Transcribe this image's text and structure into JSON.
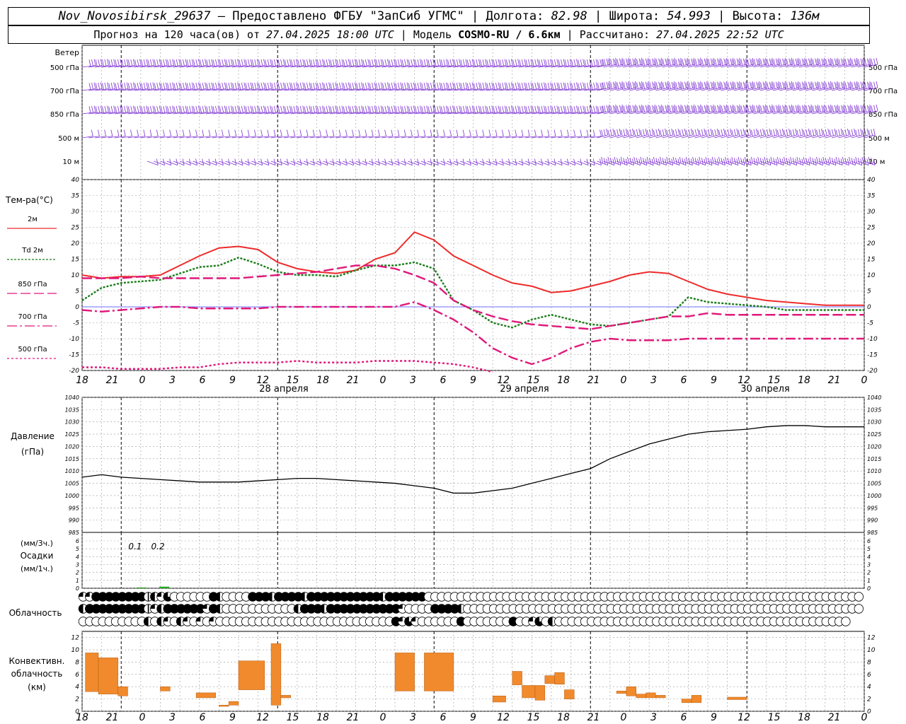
{
  "header": {
    "station": "Nov_Novosibirsk_29637",
    "provider": "— Предоставлено ФГБУ \"ЗапСиб УГМС\"",
    "lon_label": "Долгота:",
    "lon": "82.98",
    "lat_label": "Широта:",
    "lat": "54.993",
    "alt_label": "Высота:",
    "alt": "136м",
    "forecast_prefix": "Прогноз на 120 часа(ов) от",
    "forecast_start": "27.04.2025 18:00 UTC",
    "model_label": "Модель",
    "model": "COSMO-RU / 6.6км",
    "calc_label": "Рассчитано:",
    "calc_time": "27.04.2025 22:52 UTC"
  },
  "colors": {
    "wind": "#7b2fd0",
    "t2m": "#ee2b2b",
    "td2m": "#1a7d1a",
    "t850": "#e0187a",
    "t700": "#e0187a",
    "t500": "#e0187a",
    "pressure": "#000000",
    "precip": "#22aa22",
    "convective": "#f08a2c",
    "zero_line": "#4444ff",
    "grid": "#999999"
  },
  "time_axis": {
    "tick_labels": [
      "18",
      "21",
      "0",
      "3",
      "6",
      "9",
      "12",
      "15",
      "18",
      "21",
      "0",
      "3",
      "6",
      "9",
      "12",
      "15",
      "18",
      "21",
      "0",
      "3",
      "6",
      "9",
      "12",
      "15",
      "18",
      "21",
      "0"
    ],
    "day_labels": [
      {
        "index": 6,
        "text": "28 апреля"
      },
      {
        "index": 14,
        "text": "29 апреля"
      },
      {
        "index": 22,
        "text": "30 апреля"
      }
    ]
  },
  "wind_panel": {
    "title": "Ветер",
    "levels": [
      "500 гПа",
      "700 гПа",
      "850 гПа",
      "500 м",
      "10 м"
    ]
  },
  "chart_data": [
    {
      "type": "line",
      "title": "Тем-ра(°C)",
      "ylim": [
        -20,
        40
      ],
      "yticks": [
        -20,
        -15,
        -10,
        -5,
        0,
        5,
        10,
        15,
        20,
        25,
        30,
        35,
        40
      ],
      "x_hours": [
        0,
        3,
        6,
        9,
        12,
        15,
        18,
        21,
        24,
        27,
        30,
        33,
        36,
        39,
        42,
        45,
        48,
        51,
        54,
        57,
        60,
        63,
        66,
        69,
        72,
        75,
        78,
        81,
        84,
        87,
        90,
        93,
        96,
        99,
        102,
        105,
        108,
        111,
        114,
        117,
        120
      ],
      "series": [
        {
          "name": "2м",
          "key": "t2m",
          "dash": "",
          "values": [
            10,
            9,
            9.5,
            9.5,
            10,
            13,
            16,
            18.5,
            19,
            18,
            14,
            12,
            11,
            10.5,
            11.5,
            15,
            17,
            23.5,
            21,
            16,
            13,
            10,
            7.5,
            6.5,
            4.5,
            5,
            6.5,
            8,
            10,
            11,
            10.5,
            8,
            5.5,
            4,
            3,
            2,
            1.5,
            1,
            0.5,
            0.5,
            0.5
          ]
        },
        {
          "name": "Td 2м",
          "key": "td2m",
          "dash": "3,2",
          "values": [
            2,
            6,
            7.5,
            8,
            8.5,
            10.5,
            12.5,
            13,
            15.5,
            13.5,
            11,
            10,
            10,
            9.5,
            11.5,
            13,
            13,
            14,
            12,
            2,
            -1,
            -5,
            -6.5,
            -4,
            -2.5,
            -4,
            -5.5,
            -6,
            -5,
            -4,
            -3,
            3,
            1.5,
            1,
            0.5,
            0,
            -1,
            -1,
            -1,
            -1,
            -1
          ]
        },
        {
          "name": "850 гПа",
          "key": "t850",
          "dash": "14,5",
          "values": [
            9,
            9,
            9,
            9.5,
            9,
            9,
            9,
            9,
            9,
            9.5,
            10,
            10.5,
            11,
            12,
            13,
            13,
            12,
            10,
            7.5,
            2,
            -1,
            -3,
            -4.5,
            -5.5,
            -6,
            -6.5,
            -7,
            -6,
            -5,
            -4,
            -3,
            -3,
            -2,
            -2.5,
            -2.5,
            -2.5,
            -2.5,
            -2.5,
            -2.5,
            -2.5,
            -2.5
          ]
        },
        {
          "name": "700 гПа",
          "key": "t700",
          "dash": "14,4,3,4",
          "values": [
            -1,
            -1.5,
            -1,
            -0.5,
            0,
            0,
            -0.5,
            -0.5,
            -0.5,
            -0.5,
            0,
            0,
            0,
            0,
            0,
            0,
            0,
            1.5,
            -1,
            -4,
            -8,
            -13,
            -16,
            -18,
            -16,
            -13,
            -11,
            -10,
            -10.5,
            -10.5,
            -10.5,
            -10,
            -10,
            -10,
            -10,
            -10,
            -10,
            -10,
            -10,
            -10,
            -10
          ]
        },
        {
          "name": "500 гПа",
          "key": "t500",
          "dash": "3,3",
          "values": [
            -19,
            -19,
            -19.5,
            -19.5,
            -19.5,
            -19,
            -19,
            -18,
            -17.5,
            -17.5,
            -17.5,
            -17,
            -17.5,
            -17.5,
            -17.5,
            -17,
            -17,
            -17,
            -17.5,
            -18,
            -19,
            -20.5
          ]
        }
      ],
      "x_hours_t500": [
        0,
        3,
        6,
        9,
        12,
        15,
        18,
        21,
        24,
        27,
        30,
        33,
        36,
        39,
        42,
        45,
        48,
        51,
        54,
        57,
        60,
        63
      ]
    },
    {
      "type": "line",
      "title": "Давление",
      "ylabel": "(гПа)",
      "ylim": [
        985,
        1040
      ],
      "yticks": [
        985,
        990,
        995,
        1000,
        1005,
        1010,
        1015,
        1020,
        1025,
        1030,
        1035,
        1040
      ],
      "x_hours": [
        0,
        3,
        6,
        9,
        12,
        15,
        18,
        21,
        24,
        27,
        30,
        33,
        36,
        39,
        42,
        45,
        48,
        51,
        54,
        57,
        60,
        63,
        66,
        69,
        72,
        75,
        78,
        81,
        84,
        87,
        90,
        93,
        96,
        99,
        102,
        105,
        108,
        111,
        114,
        117,
        120
      ],
      "series": [
        {
          "name": "",
          "key": "pressure",
          "values": [
            1007.5,
            1008.5,
            1007.5,
            1007,
            1006.5,
            1006,
            1005.5,
            1005.5,
            1005.5,
            1006,
            1006.5,
            1007,
            1007,
            1006.5,
            1006,
            1005.5,
            1005,
            1004,
            1003,
            1001,
            1001,
            1002,
            1003,
            1005,
            1007,
            1009,
            1011,
            1015,
            1018,
            1021,
            1023,
            1025,
            1026,
            1026.5,
            1027,
            1028,
            1028.5,
            1028.5,
            1028,
            1028,
            1028
          ]
        }
      ]
    },
    {
      "type": "bar",
      "title": "Осадки",
      "ylabel_top": "(мм/3ч.)",
      "ylabel_bottom": "(мм/1ч.)",
      "ylim": [
        0,
        6
      ],
      "yticks": [
        0,
        1,
        2,
        3,
        4,
        5,
        6
      ],
      "annotations": [
        {
          "hour": 9,
          "text": "0.1"
        },
        {
          "hour": 12.5,
          "text": "0.2"
        }
      ],
      "bars": [
        {
          "hour": 9,
          "value": 0.1
        },
        {
          "hour": 12.5,
          "value": 0.2
        }
      ]
    },
    {
      "type": "table",
      "title": "Облачность",
      "rows": [
        "QQHHHHHHHHFLQEOOOOOOHLOOOOHHHLHHHHLHHHHHHHHHHHLHHHHHHOOOOOOOOOOOOOOOOOOOOOOOOOOOOOOOOOOOOOOOOOOOOOOOOOOOOOOOOOOOOOOOOOOOOOO",
        "LHHHHHHHHHFQLHHHHHHQHLOOOOOOOOOOOLHHHLHHHHHHHHHHHQOOOOHHHHLOOOOOOOOOOOOOOOOOOOOOOOOOOOOOOOOOOOOOOOOOOOOOOOOOOOOOOOOOOOOO",
        "OOOOOOOOOOLOLQOLQOQOQOOOOOOOOOOOOOOOOOOOOOOOOOOOHQEQOOOOOOHOOOOOOOHOOQEOLOOOOOOOOOOOOOOOOOOOOOOOOOOOOOOOOOOOOOOOOOOOOO"
      ]
    },
    {
      "type": "bar",
      "title": "Конвективн. облачность",
      "ylabel": "(км)",
      "ylim": [
        0,
        13
      ],
      "yticks": [
        0,
        2,
        4,
        6,
        8,
        10,
        12
      ],
      "ranges": [
        {
          "x0": 0.5,
          "x1": 2.5,
          "bottom": 3.2,
          "top": 9.5
        },
        {
          "x0": 2.5,
          "x1": 5.5,
          "bottom": 2.8,
          "top": 8.7
        },
        {
          "x0": 5.5,
          "x1": 7,
          "bottom": 2.5,
          "top": 4.0
        },
        {
          "x0": 12,
          "x1": 13.5,
          "bottom": 3.3,
          "top": 4.0
        },
        {
          "x0": 17.5,
          "x1": 20.5,
          "bottom": 2.2,
          "top": 3.0
        },
        {
          "x0": 21,
          "x1": 22.5,
          "bottom": 0.8,
          "top": 1.0
        },
        {
          "x0": 22.5,
          "x1": 24,
          "bottom": 1.0,
          "top": 1.6
        },
        {
          "x0": 24,
          "x1": 28,
          "bottom": 3.5,
          "top": 8.2
        },
        {
          "x0": 29,
          "x1": 30.5,
          "bottom": 1.0,
          "top": 11.0
        },
        {
          "x0": 30.5,
          "x1": 32,
          "bottom": 2.2,
          "top": 2.6
        },
        {
          "x0": 48,
          "x1": 51,
          "bottom": 3.3,
          "top": 9.5
        },
        {
          "x0": 52.5,
          "x1": 57,
          "bottom": 3.3,
          "top": 9.5
        },
        {
          "x0": 63,
          "x1": 65,
          "bottom": 1.5,
          "top": 2.5
        },
        {
          "x0": 66,
          "x1": 67.5,
          "bottom": 4.3,
          "top": 6.5
        },
        {
          "x0": 67.5,
          "x1": 69.5,
          "bottom": 2.2,
          "top": 4.2
        },
        {
          "x0": 69.5,
          "x1": 71,
          "bottom": 1.8,
          "top": 4.2
        },
        {
          "x0": 71,
          "x1": 72.5,
          "bottom": 4.5,
          "top": 5.8
        },
        {
          "x0": 72.5,
          "x1": 74,
          "bottom": 4.4,
          "top": 6.3
        },
        {
          "x0": 74,
          "x1": 75.5,
          "bottom": 2.0,
          "top": 3.5
        },
        {
          "x0": 82,
          "x1": 83.5,
          "bottom": 2.9,
          "top": 3.3
        },
        {
          "x0": 83.5,
          "x1": 85,
          "bottom": 2.5,
          "top": 4.0
        },
        {
          "x0": 85,
          "x1": 86.5,
          "bottom": 2.2,
          "top": 2.8
        },
        {
          "x0": 86.5,
          "x1": 88,
          "bottom": 2.2,
          "top": 3.0
        },
        {
          "x0": 88,
          "x1": 89.5,
          "bottom": 2.2,
          "top": 2.6
        },
        {
          "x0": 92,
          "x1": 93.5,
          "bottom": 1.4,
          "top": 2.0
        },
        {
          "x0": 93.5,
          "x1": 95,
          "bottom": 1.4,
          "top": 2.6
        },
        {
          "x0": 99,
          "x1": 102,
          "bottom": 1.9,
          "top": 2.3
        }
      ]
    }
  ]
}
